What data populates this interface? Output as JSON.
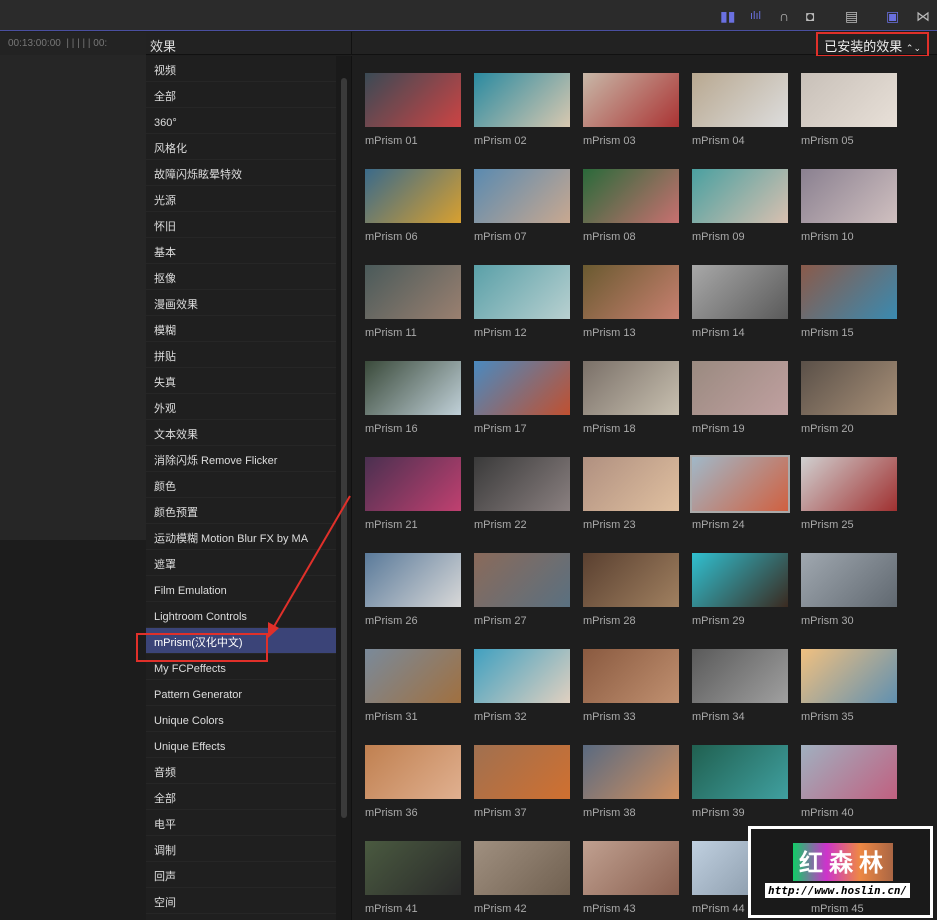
{
  "toolbar": {
    "icons": [
      "audio-video-split-icon",
      "waveform-icon",
      "headphones-icon",
      "snap-icon",
      "filmstrip-icon",
      "browser-icon",
      "transitions-icon"
    ]
  },
  "timeline": {
    "timecode": "00:13:00:00",
    "timecode2": "00:"
  },
  "header": {
    "title": "效果",
    "filter": "已安装的效果",
    "filter_icon": "⌃⌄"
  },
  "sidebar": {
    "items": [
      {
        "label": "视频"
      },
      {
        "label": "全部"
      },
      {
        "label": "360°"
      },
      {
        "label": "风格化"
      },
      {
        "label": "故障闪烁眩晕特效"
      },
      {
        "label": "光源"
      },
      {
        "label": "怀旧"
      },
      {
        "label": "基本"
      },
      {
        "label": "抠像"
      },
      {
        "label": "漫画效果"
      },
      {
        "label": "模糊"
      },
      {
        "label": "拼贴"
      },
      {
        "label": "失真"
      },
      {
        "label": "外观"
      },
      {
        "label": "文本效果"
      },
      {
        "label": "消除闪烁 Remove Flicker"
      },
      {
        "label": "颜色"
      },
      {
        "label": "颜色预置"
      },
      {
        "label": "运动模糊 Motion Blur FX by MA"
      },
      {
        "label": "遮罩"
      },
      {
        "label": "Film Emulation"
      },
      {
        "label": "Lightroom Controls"
      },
      {
        "label": "mPrism(汉化中文)",
        "selected": true
      },
      {
        "label": "My FCPeffects"
      },
      {
        "label": "Pattern Generator"
      },
      {
        "label": "Unique Colors"
      },
      {
        "label": "Unique Effects"
      },
      {
        "label": "音频"
      },
      {
        "label": "全部"
      },
      {
        "label": "电平"
      },
      {
        "label": "调制"
      },
      {
        "label": "回声"
      },
      {
        "label": "空间"
      }
    ]
  },
  "effects": [
    {
      "name": "mPrism 01",
      "c": [
        "#3a4a55",
        "#c44"
      ]
    },
    {
      "name": "mPrism 02",
      "c": [
        "#2a8aa0",
        "#d8c8b0"
      ]
    },
    {
      "name": "mPrism 03",
      "c": [
        "#c8b8a8",
        "#a33"
      ]
    },
    {
      "name": "mPrism 04",
      "c": [
        "#b8a890",
        "#ddd"
      ]
    },
    {
      "name": "mPrism 05",
      "c": [
        "#c8c0b8",
        "#e8e0d8"
      ]
    },
    {
      "name": "mPrism 06",
      "c": [
        "#3a6a8a",
        "#d8a030"
      ]
    },
    {
      "name": "mPrism 07",
      "c": [
        "#5a8ab0",
        "#c8a890"
      ]
    },
    {
      "name": "mPrism 08",
      "c": [
        "#2a6a3a",
        "#c87070"
      ]
    },
    {
      "name": "mPrism 09",
      "c": [
        "#4aa0a0",
        "#d8c0b0"
      ]
    },
    {
      "name": "mPrism 10",
      "c": [
        "#8a8090",
        "#d0c0c0"
      ]
    },
    {
      "name": "mPrism 11",
      "c": [
        "#4a5a5a",
        "#9a8070"
      ]
    },
    {
      "name": "mPrism 12",
      "c": [
        "#5aa0a8",
        "#b8d0d0"
      ]
    },
    {
      "name": "mPrism 13",
      "c": [
        "#6a5a30",
        "#c88070"
      ]
    },
    {
      "name": "mPrism 14",
      "c": [
        "#a8a8a8",
        "#5a5a5a"
      ]
    },
    {
      "name": "mPrism 15",
      "c": [
        "#8a5a4a",
        "#3a8ab0"
      ]
    },
    {
      "name": "mPrism 16",
      "c": [
        "#3a4a3a",
        "#c0d0d8"
      ]
    },
    {
      "name": "mPrism 17",
      "c": [
        "#4a8ac0",
        "#c05030"
      ]
    },
    {
      "name": "mPrism 18",
      "c": [
        "#7a7068",
        "#c8c0b0"
      ]
    },
    {
      "name": "mPrism 19",
      "c": [
        "#9a8a80",
        "#c0a0a0"
      ]
    },
    {
      "name": "mPrism 20",
      "c": [
        "#5a5048",
        "#a89078"
      ]
    },
    {
      "name": "mPrism 21",
      "c": [
        "#4a3050",
        "#c04070"
      ]
    },
    {
      "name": "mPrism 22",
      "c": [
        "#3a3a3a",
        "#8a8080"
      ]
    },
    {
      "name": "mPrism 23",
      "c": [
        "#b09080",
        "#e0c0a0"
      ]
    },
    {
      "name": "mPrism 24",
      "c": [
        "#a0b8c8",
        "#d06040"
      ]
    },
    {
      "name": "mPrism 25",
      "c": [
        "#d0d0d0",
        "#a03030"
      ]
    },
    {
      "name": "mPrism 26",
      "c": [
        "#5a7a9a",
        "#d8d8d8"
      ]
    },
    {
      "name": "mPrism 27",
      "c": [
        "#8a6a5a",
        "#5a7080"
      ]
    },
    {
      "name": "mPrism 28",
      "c": [
        "#5a4030",
        "#a08060"
      ]
    },
    {
      "name": "mPrism 29",
      "c": [
        "#30c0d0",
        "#3a2a20"
      ]
    },
    {
      "name": "mPrism 30",
      "c": [
        "#a0a8b0",
        "#606870"
      ]
    },
    {
      "name": "mPrism 31",
      "c": [
        "#7a8a9a",
        "#a07040"
      ]
    },
    {
      "name": "mPrism 32",
      "c": [
        "#40a0c0",
        "#e0d0c0"
      ]
    },
    {
      "name": "mPrism 33",
      "c": [
        "#8a5a40",
        "#c09070"
      ]
    },
    {
      "name": "mPrism 34",
      "c": [
        "#5a5a5a",
        "#a0a0a0"
      ]
    },
    {
      "name": "mPrism 35",
      "c": [
        "#f0c080",
        "#6090b0"
      ]
    },
    {
      "name": "mPrism 36",
      "c": [
        "#c08050",
        "#e0b090"
      ]
    },
    {
      "name": "mPrism 37",
      "c": [
        "#a07050",
        "#d07030"
      ]
    },
    {
      "name": "mPrism 38",
      "c": [
        "#5a6a80",
        "#d09060"
      ]
    },
    {
      "name": "mPrism 39",
      "c": [
        "#206050",
        "#40a0a0"
      ]
    },
    {
      "name": "mPrism 40",
      "c": [
        "#a0b0c0",
        "#c06080"
      ]
    },
    {
      "name": "mPrism 41",
      "c": [
        "#4a5a40",
        "#2a2a2a"
      ]
    },
    {
      "name": "mPrism 42",
      "c": [
        "#a09080",
        "#706050"
      ]
    },
    {
      "name": "mPrism 43",
      "c": [
        "#c0a090",
        "#8a6050"
      ]
    },
    {
      "name": "mPrism 44",
      "c": [
        "#c0d0e0",
        "#8090a0"
      ]
    },
    {
      "name": "mPrism 45",
      "c": [
        "#30a080",
        "#c04060"
      ]
    }
  ],
  "watermark": {
    "logo": "红森林",
    "url": "http://www.hoslin.cn/"
  },
  "annotation_color": "#e0302a"
}
